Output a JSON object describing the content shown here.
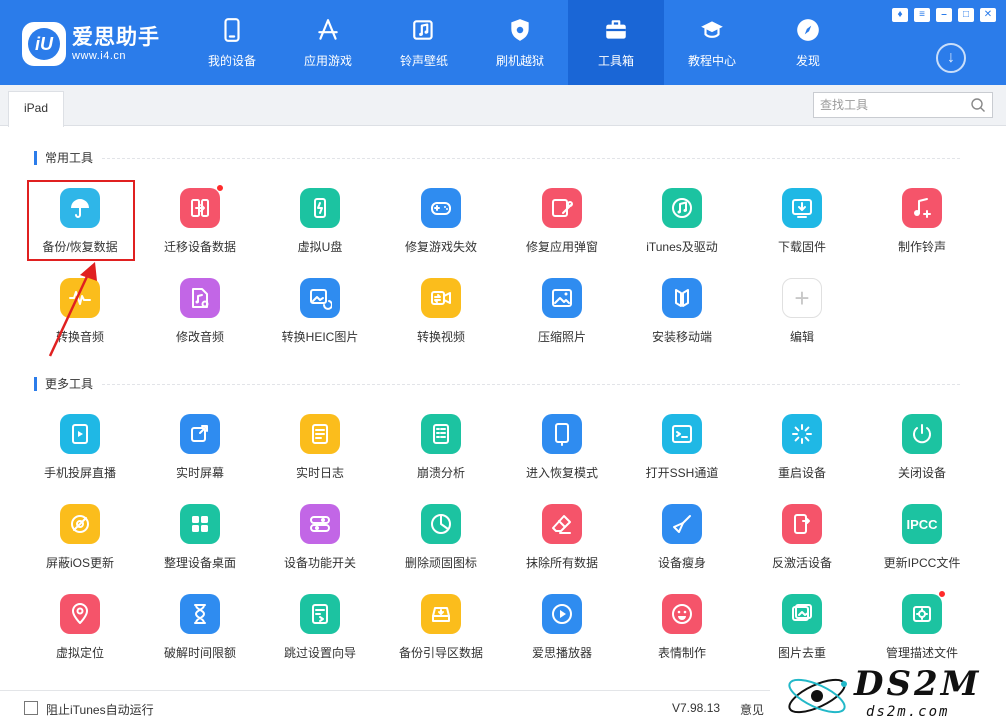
{
  "app": {
    "name": "爱思助手",
    "url": "www.i4.cn",
    "logo_mark": "iU"
  },
  "nav": [
    {
      "label": "我的设备",
      "icon": "phone-icon"
    },
    {
      "label": "应用游戏",
      "icon": "app-store-icon"
    },
    {
      "label": "铃声壁纸",
      "icon": "music-note-icon"
    },
    {
      "label": "刷机越狱",
      "icon": "shield-icon"
    },
    {
      "label": "工具箱",
      "icon": "toolbox-icon",
      "active": true
    },
    {
      "label": "教程中心",
      "icon": "graduation-cap-icon"
    },
    {
      "label": "发现",
      "icon": "compass-icon"
    }
  ],
  "tab": {
    "label": "iPad"
  },
  "search": {
    "placeholder": "查找工具"
  },
  "sections": {
    "common": "常用工具",
    "more": "更多工具"
  },
  "common_tools": [
    {
      "label": "备份/恢复数据",
      "icon": "umbrella-icon",
      "color": "#2fb6e8"
    },
    {
      "label": "迁移设备数据",
      "icon": "migrate-icon",
      "color": "#f5546a",
      "badge": true
    },
    {
      "label": "虚拟U盘",
      "icon": "usb-drive-icon",
      "color": "#1cc3a1"
    },
    {
      "label": "修复游戏失效",
      "icon": "gamepad-icon",
      "color": "#2f8cf0"
    },
    {
      "label": "修复应用弹窗",
      "icon": "wrench-icon",
      "color": "#f5546a"
    },
    {
      "label": "iTunes及驱动",
      "icon": "itunes-icon",
      "color": "#1cc3a1"
    },
    {
      "label": "下载固件",
      "icon": "download-box-icon",
      "color": "#1fb8e5"
    },
    {
      "label": "制作铃声",
      "icon": "ringtone-icon",
      "color": "#f5546a"
    },
    {
      "label": "转换音频",
      "icon": "audio-wave-icon",
      "color": "#fbbd1c"
    },
    {
      "label": "修改音频",
      "icon": "audio-edit-icon",
      "color": "#c266e6"
    },
    {
      "label": "转换HEIC图片",
      "icon": "image-convert-icon",
      "color": "#2f8cf0"
    },
    {
      "label": "转换视频",
      "icon": "video-convert-icon",
      "color": "#fbbd1c"
    },
    {
      "label": "压缩照片",
      "icon": "photo-compress-icon",
      "color": "#2f8cf0"
    },
    {
      "label": "安装移动端",
      "icon": "install-mobile-icon",
      "color": "#2f8cf0"
    },
    {
      "label": "编辑",
      "icon": "plus-icon",
      "color": "#ffffff",
      "add": true
    }
  ],
  "more_tools": [
    {
      "label": "手机投屏直播",
      "icon": "screen-cast-icon",
      "color": "#1fb8e5"
    },
    {
      "label": "实时屏幕",
      "icon": "live-screen-icon",
      "color": "#2f8cf0"
    },
    {
      "label": "实时日志",
      "icon": "log-icon",
      "color": "#fbbd1c"
    },
    {
      "label": "崩溃分析",
      "icon": "crash-report-icon",
      "color": "#1cc3a1"
    },
    {
      "label": "进入恢复模式",
      "icon": "recovery-mode-icon",
      "color": "#2f8cf0"
    },
    {
      "label": "打开SSH通道",
      "icon": "terminal-icon",
      "color": "#1fb8e5"
    },
    {
      "label": "重启设备",
      "icon": "restart-icon",
      "color": "#1fb8e5"
    },
    {
      "label": "关闭设备",
      "icon": "power-icon",
      "color": "#1cc3a1"
    },
    {
      "label": "屏蔽iOS更新",
      "icon": "block-update-icon",
      "color": "#fbbd1c"
    },
    {
      "label": "整理设备桌面",
      "icon": "grid-icon",
      "color": "#1cc3a1"
    },
    {
      "label": "设备功能开关",
      "icon": "toggle-icon",
      "color": "#c266e6"
    },
    {
      "label": "删除顽固图标",
      "icon": "pie-icon",
      "color": "#1cc3a1"
    },
    {
      "label": "抹除所有数据",
      "icon": "eraser-icon",
      "color": "#f5546a"
    },
    {
      "label": "设备瘦身",
      "icon": "broom-icon",
      "color": "#2f8cf0"
    },
    {
      "label": "反激活设备",
      "icon": "deactivate-icon",
      "color": "#f5546a"
    },
    {
      "label": "更新IPCC文件",
      "icon": "ipcc-icon",
      "color": "#1cc3a1",
      "text": "IPCC"
    },
    {
      "label": "虚拟定位",
      "icon": "location-pin-icon",
      "color": "#f5546a"
    },
    {
      "label": "破解时间限额",
      "icon": "hourglass-icon",
      "color": "#2f8cf0"
    },
    {
      "label": "跳过设置向导",
      "icon": "skip-setup-icon",
      "color": "#1cc3a1"
    },
    {
      "label": "备份引导区数据",
      "icon": "boot-backup-icon",
      "color": "#fbbd1c"
    },
    {
      "label": "爱思播放器",
      "icon": "play-icon",
      "color": "#2f8cf0"
    },
    {
      "label": "表情制作",
      "icon": "emoji-icon",
      "color": "#f5546a"
    },
    {
      "label": "图片去重",
      "icon": "dedupe-image-icon",
      "color": "#1cc3a1"
    },
    {
      "label": "管理描述文件",
      "icon": "profile-gear-icon",
      "color": "#1cc3a1",
      "badge": true
    }
  ],
  "footer": {
    "checkbox_label": "阻止iTunes自动运行",
    "version": "V7.98.13",
    "feedback": "意见"
  },
  "watermark": {
    "main": "DS2M",
    "sub": "ds2m.com"
  }
}
